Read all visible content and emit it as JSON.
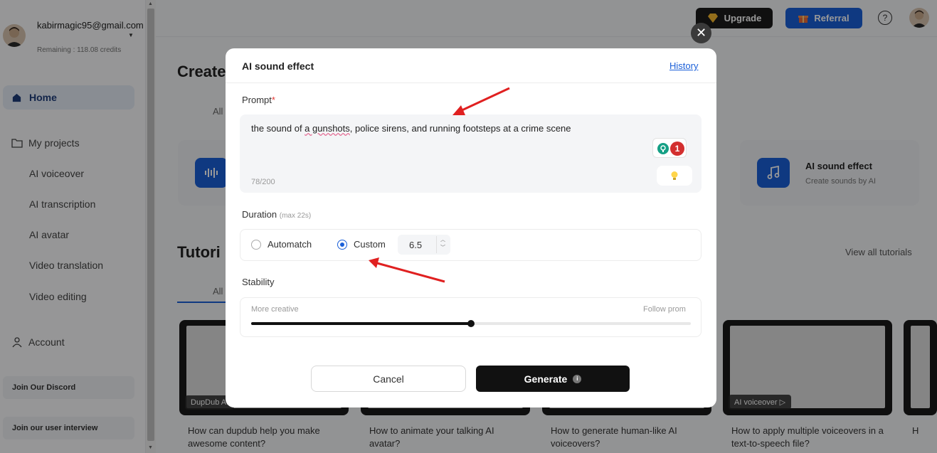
{
  "sidebar": {
    "email": "kabirmagic95@gmail.com",
    "credits": "Remaining : 118.08 credits",
    "home": "Home",
    "my_projects": "My projects",
    "sub_items": [
      "AI voiceover",
      "AI transcription",
      "AI avatar",
      "Video translation",
      "Video editing"
    ],
    "account": "Account",
    "discord": "Join Our Discord",
    "interview": "Join our user interview"
  },
  "topbar": {
    "upgrade": "Upgrade",
    "referral": "Referral",
    "help": "?"
  },
  "background": {
    "create_title": "Create",
    "tab_all_1": "All",
    "tutorials_title": "Tutori",
    "tab_all_2": "All",
    "view_all": "View all tutorials",
    "sound_card_title": "AI sound effect",
    "sound_card_sub": "Create sounds by AI",
    "tutorials": [
      {
        "tag": "DupDub AI",
        "text": "How can dupdub help you make awesome content?"
      },
      {
        "tag": "",
        "text": "How to animate your talking AI avatar?"
      },
      {
        "tag": "",
        "text": "How to generate human-like AI voiceovers?"
      },
      {
        "tag": "AI voiceover",
        "text": "How to apply multiple voiceovers in a text-to-speech file?"
      }
    ],
    "partial_text": "H"
  },
  "modal": {
    "title": "AI sound effect",
    "history": "History",
    "prompt_label": "Prompt",
    "prompt_required": "*",
    "prompt_pre": "the sound of ",
    "prompt_error": "a gunshots",
    "prompt_post": ", police sirens, and running footsteps at a crime scene",
    "prompt_count": "78/200",
    "grammar_count": "1",
    "duration_label": "Duration",
    "duration_hint": "(max 22s)",
    "option_automatch": "Automatch",
    "option_custom": "Custom",
    "selected_option": "Custom",
    "duration_value": "6.5",
    "stability_label": "Stability",
    "stability_left": "More creative",
    "stability_right": "Follow prom",
    "stability_level": 0.5,
    "cancel": "Cancel",
    "generate": "Generate",
    "generate_info": "i"
  },
  "colors": {
    "accent": "#1a5fd8",
    "arrow": "#e02020",
    "required": "#e53935"
  }
}
